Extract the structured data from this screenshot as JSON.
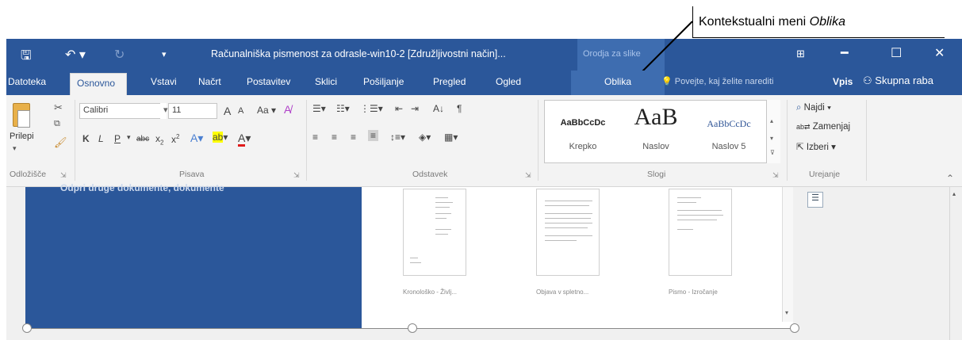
{
  "annotation": {
    "text_plain": "Kontekstualni meni ",
    "text_italic": "Oblika"
  },
  "titlebar": {
    "title": "Računalniška pismenost za odrasle-win10-2 [Združljivostni način]...",
    "context_group": "Orodja za slike",
    "icons": [
      "save-icon",
      "undo-icon",
      "redo-icon",
      "customize-icon",
      "ribbon-display-icon",
      "minimize-icon",
      "maximize-icon",
      "close-icon"
    ]
  },
  "tabs": {
    "items": [
      "Datoteka",
      "Osnovno",
      "Vstavi",
      "Načrt",
      "Postavitev",
      "Sklici",
      "Pošiljanje",
      "Pregled",
      "Ogled",
      "Oblika"
    ],
    "active": "Osnovno",
    "tell_me": "Povejte, kaj želite narediti",
    "sign_in": "Vpis",
    "share": "Skupna raba"
  },
  "ribbon": {
    "clipboard": {
      "paste": "Prilepi",
      "label": "Odložišče"
    },
    "font": {
      "name": "Calibri",
      "size": "11",
      "grow": "A",
      "shrink": "A",
      "case": "Aa",
      "bold": "K",
      "italic": "L",
      "underline": "P",
      "strike": "abc",
      "sub": "x",
      "sup": "x",
      "label": "Pisava"
    },
    "paragraph": {
      "label": "Odstavek",
      "sort": "A↓",
      "pilcrow": "¶"
    },
    "styles": {
      "items": [
        {
          "preview": "AaBbCcDc",
          "name": "Krepko"
        },
        {
          "preview": "AaB",
          "name": "Naslov"
        },
        {
          "preview": "AaBbCcDc",
          "name": "Naslov 5"
        }
      ],
      "label": "Slogi"
    },
    "editing": {
      "find": "Najdi",
      "replace": "Zamenjaj",
      "select": "Izberi",
      "label": "Urejanje"
    }
  },
  "document": {
    "blue_text": "Odpri druge dokumente, dokumente",
    "thumbnails": [
      {
        "label": "Kronološko - Življ..."
      },
      {
        "label": "Objava v spletno..."
      },
      {
        "label": "Pismo - Izročanje"
      }
    ]
  }
}
